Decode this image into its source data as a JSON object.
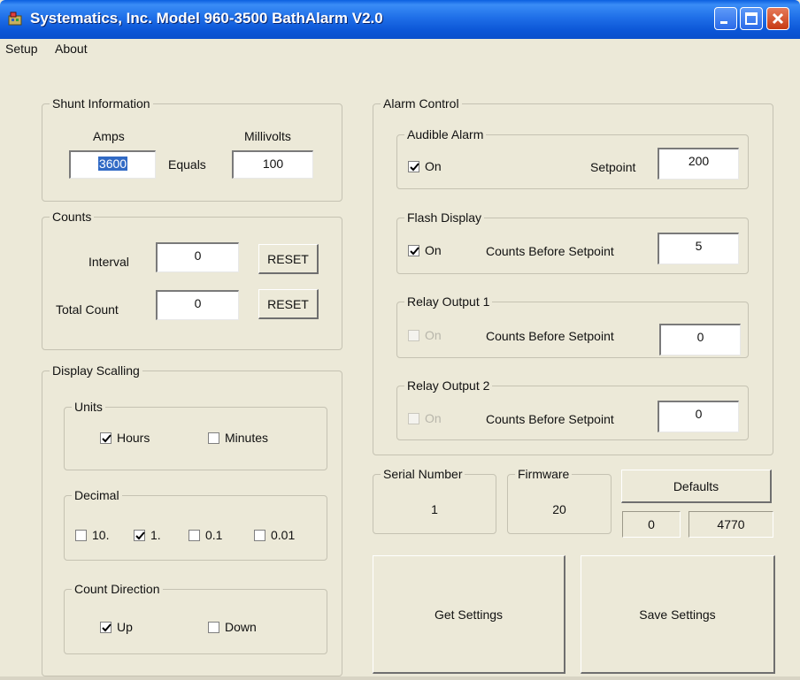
{
  "window": {
    "title": "Systematics, Inc.  Model 960-3500 BathAlarm V2.0",
    "icons": [
      "app-icon",
      "minimize-icon",
      "maximize-icon",
      "close-icon"
    ]
  },
  "menu": {
    "items": [
      "Setup",
      "About"
    ]
  },
  "shunt": {
    "legend": "Shunt Information",
    "amps_label": "Amps",
    "millivolts_label": "Millivolts",
    "amps_value": "3600",
    "equals_label": "Equals",
    "millivolts_value": "100"
  },
  "counts": {
    "legend": "Counts",
    "interval_label": "Interval",
    "interval_value": "0",
    "total_label": "Total Count",
    "total_value": "0",
    "reset_label": "RESET"
  },
  "display_scaling": {
    "legend": "Display Scalling",
    "units": {
      "legend": "Units",
      "hours": "Hours",
      "hours_checked": true,
      "minutes": "Minutes",
      "minutes_checked": false
    },
    "decimal": {
      "legend": "Decimal",
      "options": [
        {
          "label": "10.",
          "checked": false
        },
        {
          "label": "1.",
          "checked": true
        },
        {
          "label": "0.1",
          "checked": false
        },
        {
          "label": "0.01",
          "checked": false
        }
      ]
    },
    "count_direction": {
      "legend": "Count Direction",
      "up": "Up",
      "up_checked": true,
      "down": "Down",
      "down_checked": false
    }
  },
  "alarm_control": {
    "legend": "Alarm Control",
    "audible": {
      "legend": "Audible Alarm",
      "on_label": "On",
      "on_checked": true,
      "setpoint_label": "Setpoint",
      "setpoint_value": "200"
    },
    "flash": {
      "legend": "Flash Display",
      "on_label": "On",
      "on_checked": true,
      "cbs_label": "Counts Before Setpoint",
      "value": "5"
    },
    "relay1": {
      "legend": "Relay Output 1",
      "on_label": "On",
      "on_checked": false,
      "enabled": false,
      "cbs_label": "Counts Before Setpoint",
      "value": "0"
    },
    "relay2": {
      "legend": "Relay Output 2",
      "on_label": "On",
      "on_checked": false,
      "enabled": false,
      "cbs_label": "Counts Before Setpoint",
      "value": "0"
    }
  },
  "serial": {
    "legend": "Serial Number",
    "value": "1"
  },
  "firmware": {
    "legend": "Firmware",
    "value": "20"
  },
  "defaults": {
    "label": "Defaults",
    "field1": "0",
    "field2": "4770"
  },
  "actions": {
    "get_label": "Get Settings",
    "save_label": "Save Settings"
  },
  "colors": {
    "title_bar": "#1f6fe8",
    "window_bg": "#ece9d8",
    "selection": "#316ac5",
    "close_button": "#c73a12"
  }
}
